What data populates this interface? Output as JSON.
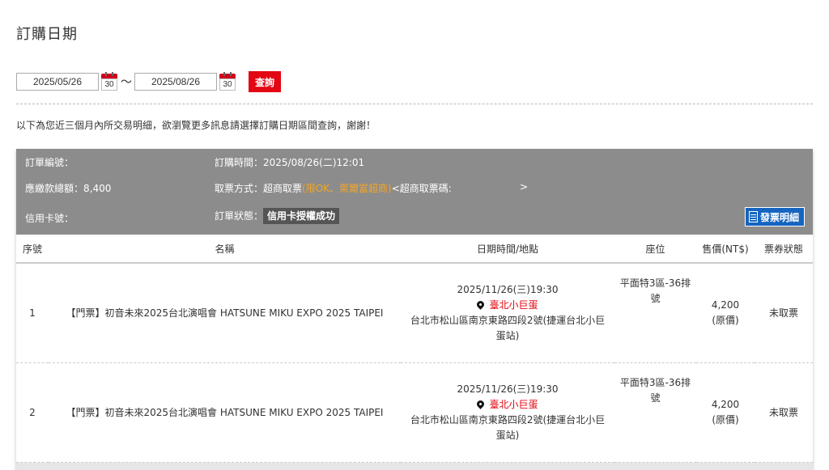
{
  "page_title": "訂購日期",
  "date_filter": {
    "start_date": "2025/05/26",
    "end_date": "2025/08/26",
    "calendar_day": "30",
    "separator": "～",
    "search_label": "查詢"
  },
  "notice": "以下為您近三個月內所交易明細，欲瀏覽更多訊息請選擇訂購日期區間查詢，謝謝！",
  "order": {
    "order_no_label": "訂單編號：",
    "order_time_label": "訂購時間：",
    "order_time": "2025/08/26(二)12:01",
    "amount_label": "應繳款總額：",
    "amount": "8,400",
    "pickup_label": "取票方式：",
    "pickup_method": "超商取票",
    "pickup_note": "(限OK、萊爾富超商)",
    "pickup_code_label": "<超商取票碼:",
    "pickup_code_end": ">",
    "card_label": "信用卡號：",
    "status_label": "訂單狀態：",
    "status": "信用卡授權成功",
    "invoice_label": "發票明細"
  },
  "table": {
    "headers": [
      "序號",
      "名稱",
      "日期時間/地點",
      "座位",
      "售價(NT$)",
      "票券狀態"
    ],
    "rows": [
      {
        "no": "1",
        "name": "【門票】初音未來2025台北演唱會 HATSUNE MIKU EXPO 2025 TAIPEI",
        "datetime": "2025/11/26(三)19:30",
        "venue": "臺北小巨蛋",
        "address": "台北市松山區南京東路四段2號(捷運台北小巨蛋站)",
        "seat": "平面特3區-36排號",
        "price": "4,200",
        "price_note": "(原價)",
        "status": "未取票"
      },
      {
        "no": "2",
        "name": "【門票】初音未來2025台北演唱會 HATSUNE MIKU EXPO 2025 TAIPEI",
        "datetime": "2025/11/26(三)19:30",
        "venue": "臺北小巨蛋",
        "address": "台北市松山區南京東路四段2號(捷運台北小巨蛋站)",
        "seat": "平面特3區-36排號",
        "price": "4,200",
        "price_note": "(原價)",
        "status": "未取票"
      }
    ]
  },
  "colors": {
    "accent_red": "#e30613",
    "header_gray": "#8c8c8c",
    "invoice_blue": "#1565c0",
    "note_orange": "#f5a623"
  },
  "icons": [
    "calendar-icon",
    "location-pin-icon",
    "invoice-icon"
  ]
}
